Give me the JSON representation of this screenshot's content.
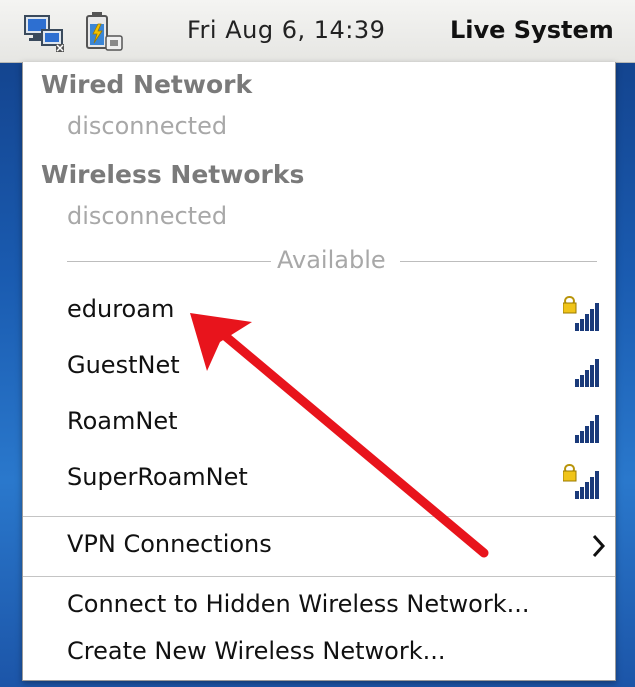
{
  "panel": {
    "clock": "Fri Aug  6, 14:39",
    "user": "Live System",
    "icons": [
      "network-manager-icon",
      "battery-power-icon"
    ]
  },
  "menu": {
    "wired": {
      "title": "Wired Network",
      "status": "disconnected"
    },
    "wireless": {
      "title": "Wireless Networks",
      "status": "disconnected"
    },
    "available_label": "Available",
    "networks": [
      {
        "name": "eduroam",
        "secured": true,
        "icon": "signal-strength-locked-icon"
      },
      {
        "name": "GuestNet",
        "secured": false,
        "icon": "signal-strength-icon"
      },
      {
        "name": "RoamNet",
        "secured": false,
        "icon": "signal-strength-icon"
      },
      {
        "name": "SuperRoamNet",
        "secured": true,
        "icon": "signal-strength-locked-icon"
      }
    ],
    "vpn": {
      "label": "VPN Connections",
      "icon": "chevron-right-icon"
    },
    "actions": [
      "Connect to Hidden Wireless Network...",
      "Create New Wireless Network..."
    ]
  },
  "annotation": {
    "color": "#e8141c",
    "points_to": "eduroam"
  }
}
